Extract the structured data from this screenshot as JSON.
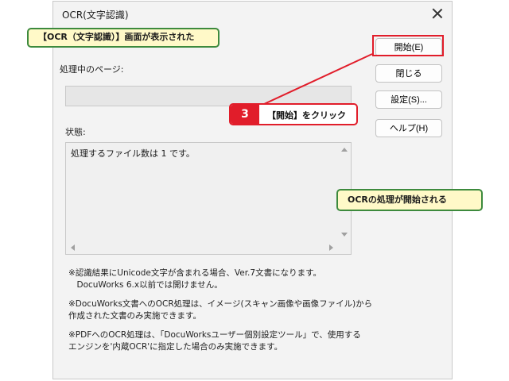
{
  "dialog": {
    "title": "OCR(文字認識)",
    "processing_label": "処理中のページ:",
    "status_label": "状態:",
    "status_text": "処理するファイル数は 1 です。"
  },
  "buttons": {
    "start": "開始(E)",
    "close": "閉じる",
    "settings": "設定(S)...",
    "help": "ヘルプ(H)"
  },
  "notes": [
    "※認識結果にUnicode文字が含まれる場合、Ver.7文書になります。\n　DocuWorks 6.x以前では開けません。",
    "※DocuWorks文書へのOCR処理は、イメージ(スキャン画像や画像ファイル)から\n作成された文書のみ実施できます。",
    "※PDFへのOCR処理は、「DocuWorksユーザー個別設定ツール」で、使用する\nエンジンを'内蔵OCR'に指定した場合のみ実施できます。"
  ],
  "callouts": {
    "screen_shown": "【OCR（文字認識）】画面が表示された",
    "step_number": "3",
    "step_text": "【開始】をクリック",
    "ocr_started": "OCRの処理が開始される"
  },
  "colors": {
    "callout_red": "#e11d2a",
    "callout_green_border": "#3d8a3d",
    "callout_yellow_bg": "#fff9c8"
  }
}
